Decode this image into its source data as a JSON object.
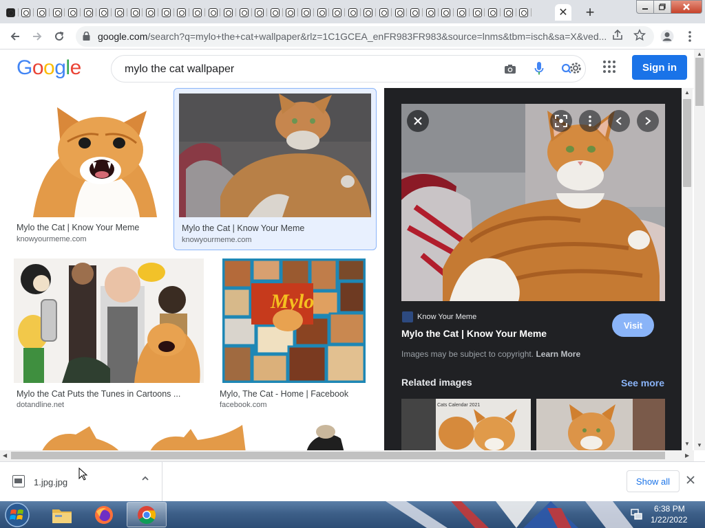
{
  "browser": {
    "tab_count": 34,
    "url_host": "google.com",
    "url_rest": "/search?q=mylo+the+cat+wallpaper&rlz=1C1GCEA_enFR983FR983&source=lnms&tbm=isch&sa=X&ved...",
    "close_glyph": "✕",
    "new_tab_glyph": "+"
  },
  "google": {
    "logo": [
      "G",
      "o",
      "o",
      "g",
      "l",
      "e"
    ],
    "logo_colors": [
      "#4285F4",
      "#EA4335",
      "#FBBC05",
      "#4285F4",
      "#34A853",
      "#EA4335"
    ],
    "search_query": "mylo the cat wallpaper",
    "signin_label": "Sign in",
    "accent": "#1a73e8"
  },
  "results": [
    {
      "title": "Mylo the Cat | Know Your Meme",
      "source": "knowyourmeme.com"
    },
    {
      "title": "Mylo the Cat | Know Your Meme",
      "source": "knowyourmeme.com"
    },
    {
      "title": "Mylo the Cat Puts the Tunes in Cartoons ...",
      "source": "dotandline.net"
    },
    {
      "title": "Mylo, The Cat - Home | Facebook",
      "source": "facebook.com"
    }
  ],
  "preview": {
    "source_name": "Know Your Meme",
    "title": "Mylo the Cat | Know Your Meme",
    "visit_label": "Visit",
    "copyright_text": "Images may be subject to copyright.",
    "learn_more": "Learn More",
    "related_title": "Related images",
    "see_more": "See more",
    "related_caption": "Cats Calendar 2021"
  },
  "collage_text": "Mylo",
  "downloads": {
    "file_name": "1.jpg.jpg",
    "show_all": "Show all"
  },
  "taskbar": {
    "time": "6:38 PM",
    "date": "1/22/2022"
  }
}
